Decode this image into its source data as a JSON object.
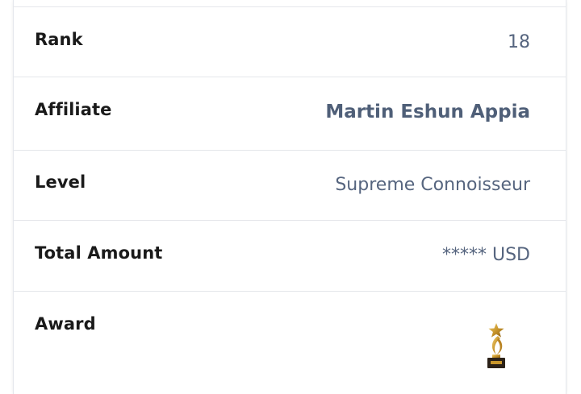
{
  "rows": {
    "rank": {
      "label": "Rank",
      "value": "18"
    },
    "affiliate": {
      "label": "Affiliate",
      "value": "Martin Eshun Appia"
    },
    "level": {
      "label": "Level",
      "value": "Supreme Connoisseur"
    },
    "total_amount": {
      "label": "Total Amount",
      "value": "***** USD"
    },
    "award": {
      "label": "Award",
      "icon": "trophy-star-icon"
    }
  },
  "colors": {
    "label": "#1a1a1a",
    "value": "#56657f",
    "border": "#e5e7eb",
    "trophy_gold": "#c9962b",
    "trophy_base": "#2b2118"
  }
}
